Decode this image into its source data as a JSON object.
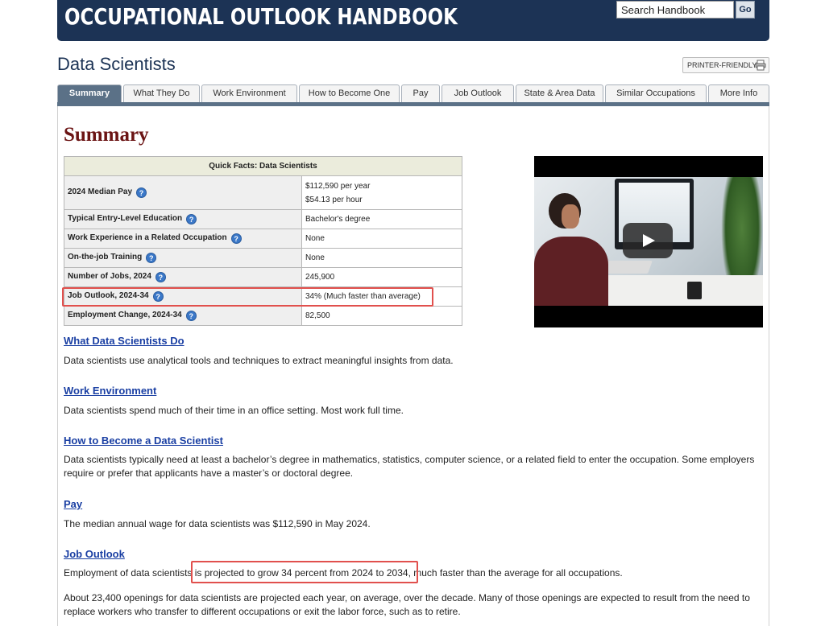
{
  "header": {
    "site_title": "OCCUPATIONAL OUTLOOK HANDBOOK",
    "search_placeholder": "Search Handbook",
    "go_label": "Go"
  },
  "page": {
    "title": "Data Scientists",
    "printer_label": "PRINTER-FRIENDLY",
    "printer_icon": "printer-icon"
  },
  "tabs": [
    {
      "label": "Summary",
      "active": true
    },
    {
      "label": "What They Do"
    },
    {
      "label": "Work Environment"
    },
    {
      "label": "How to Become One"
    },
    {
      "label": "Pay"
    },
    {
      "label": "Job Outlook"
    },
    {
      "label": "State & Area Data"
    },
    {
      "label": "Similar Occupations"
    },
    {
      "label": "More Info"
    }
  ],
  "summary": {
    "heading": "Summary",
    "quick_facts": {
      "caption": "Quick Facts: Data Scientists",
      "help_icon": "help-icon",
      "rows": [
        {
          "label": "2024 Median Pay",
          "value": "$112,590 per year",
          "value2": "$54.13 per hour"
        },
        {
          "label": "Typical Entry-Level Education",
          "value": "Bachelor's degree"
        },
        {
          "label": "Work Experience in a Related Occupation",
          "value": "None"
        },
        {
          "label": "On-the-job Training",
          "value": "None"
        },
        {
          "label": "Number of Jobs, 2024",
          "value": "245,900"
        },
        {
          "label": "Job Outlook, 2024-34",
          "value": "34% (Much faster than average)"
        },
        {
          "label": "Employment Change, 2024-34",
          "value": "82,500"
        }
      ]
    },
    "video": {
      "play_icon": "play-icon"
    },
    "highlight_color": "#e1504d"
  },
  "sections": [
    {
      "title": "What Data Scientists Do",
      "text": "Data scientists use analytical tools and techniques to extract meaningful insights from data."
    },
    {
      "title": "Work Environment",
      "text": "Data scientists spend much of their time in an office setting. Most work full time."
    },
    {
      "title": "How to Become a Data Scientist",
      "text": "Data scientists typically need at least a bachelor’s degree in mathematics, statistics, computer science, or a related field to enter the occupation. Some employers require or prefer that applicants have a master’s or doctoral degree."
    },
    {
      "title": "Pay",
      "text": "The median annual wage for data scientists was $112,590 in May 2024."
    },
    {
      "title": "Job Outlook",
      "text": "Employment of data scientists is projected to grow 34 percent from 2024 to 2034, much faster than the average for all occupations.",
      "text2": "About 23,400 openings for data scientists are projected each year, on average, over the decade. Many of those openings are expected to result from the need to replace workers who transfer to different occupations or exit the labor force, such as to retire."
    }
  ],
  "colors": {
    "banner": "#1c3355",
    "tab_active": "#5b7187",
    "heading": "#6b1414",
    "link": "#1a3fa3"
  }
}
